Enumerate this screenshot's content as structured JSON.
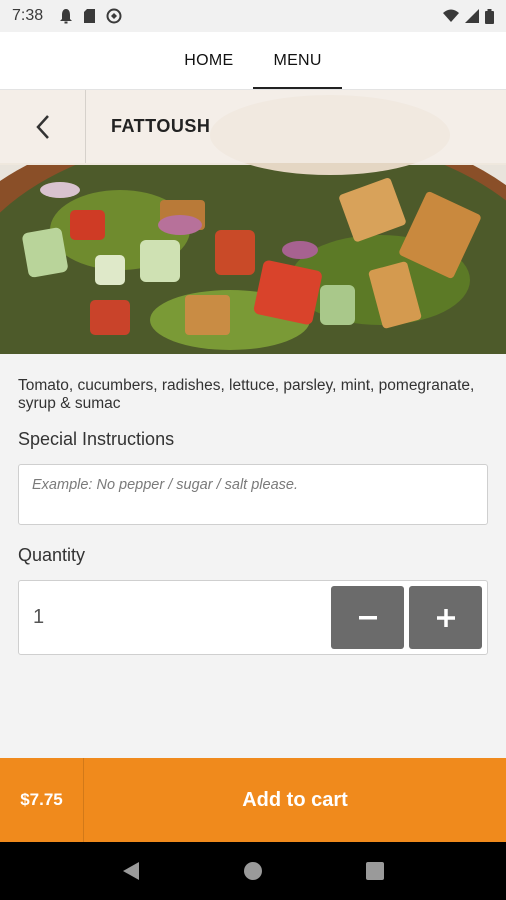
{
  "status_bar": {
    "time": "7:38",
    "icons": [
      "notification-bell-icon",
      "sd-card-icon",
      "sync-icon"
    ],
    "right_icons": [
      "wifi-icon",
      "signal-icon",
      "battery-icon"
    ]
  },
  "nav": {
    "tabs": [
      {
        "label": "HOME",
        "active": false
      },
      {
        "label": "MENU",
        "active": true
      }
    ]
  },
  "item": {
    "title": "FATTOUSH",
    "description": "Tomato, cucumbers, radishes, lettuce, parsley, mint, pomegranate, syrup & sumac"
  },
  "instructions": {
    "label": "Special Instructions",
    "placeholder": "Example: No pepper / sugar / salt please."
  },
  "quantity": {
    "label": "Quantity",
    "value": "1",
    "decrement_icon": "minus-icon",
    "increment_icon": "plus-icon"
  },
  "cart": {
    "price": "$7.75",
    "action_label": "Add to cart"
  },
  "colors": {
    "accent": "#f08a1c",
    "stepper": "#6b6b6b"
  },
  "system_nav": [
    "back-triangle-icon",
    "home-circle-icon",
    "recents-square-icon"
  ]
}
